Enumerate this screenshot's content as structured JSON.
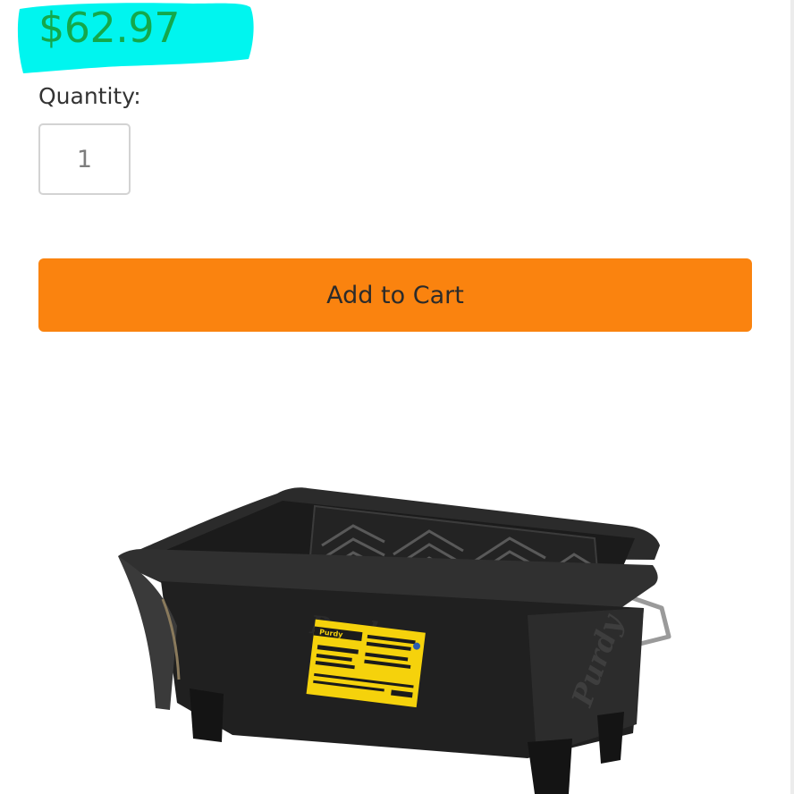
{
  "product": {
    "price": "$62.97",
    "price_color": "#14a84b",
    "highlight_color": "#00f5ef",
    "quantity_label": "Quantity:",
    "quantity_value": "1",
    "add_to_cart_label": "Add to Cart",
    "button_color": "#fa830f",
    "image": {
      "brand": "Purdy",
      "label_color": "#f5d20c"
    }
  }
}
